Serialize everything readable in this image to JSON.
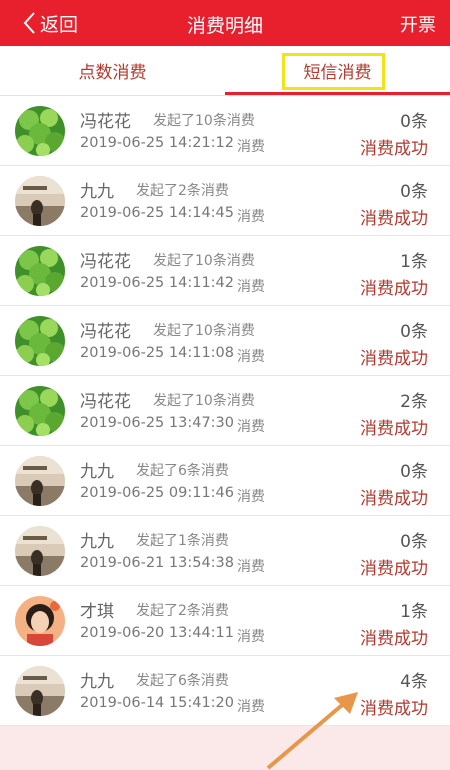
{
  "header": {
    "back_label": "返回",
    "title": "消费明细",
    "invoice_label": "开票"
  },
  "tabs": [
    {
      "label": "点数消费"
    },
    {
      "label": "短信消费"
    }
  ],
  "active_tab": 1,
  "records": [
    {
      "name": "冯花花",
      "desc": "发起了10条消费",
      "datetime": "2019-06-25 14:21:12",
      "type": "消费",
      "count": "0条",
      "status": "消费成功",
      "avatar": "leaf-avatar"
    },
    {
      "name": "九九",
      "desc": "发起了2条消费",
      "datetime": "2019-06-25 14:14:45",
      "type": "消费",
      "count": "0条",
      "status": "消费成功",
      "avatar": "room-avatar"
    },
    {
      "name": "冯花花",
      "desc": "发起了10条消费",
      "datetime": "2019-06-25 14:11:42",
      "type": "消费",
      "count": "1条",
      "status": "消费成功",
      "avatar": "leaf-avatar"
    },
    {
      "name": "冯花花",
      "desc": "发起了10条消费",
      "datetime": "2019-06-25 14:11:08",
      "type": "消费",
      "count": "0条",
      "status": "消费成功",
      "avatar": "leaf-avatar"
    },
    {
      "name": "冯花花",
      "desc": "发起了10条消费",
      "datetime": "2019-06-25 13:47:30",
      "type": "消费",
      "count": "2条",
      "status": "消费成功",
      "avatar": "leaf-avatar"
    },
    {
      "name": "九九",
      "desc": "发起了6条消费",
      "datetime": "2019-06-25 09:11:46",
      "type": "消费",
      "count": "0条",
      "status": "消费成功",
      "avatar": "room-avatar"
    },
    {
      "name": "九九",
      "desc": "发起了1条消费",
      "datetime": "2019-06-21 13:54:38",
      "type": "消费",
      "count": "0条",
      "status": "消费成功",
      "avatar": "room-avatar"
    },
    {
      "name": "才琪",
      "desc": "发起了2条消费",
      "datetime": "2019-06-20 13:44:11",
      "type": "消费",
      "count": "1条",
      "status": "消费成功",
      "avatar": "girl-avatar"
    },
    {
      "name": "九九",
      "desc": "发起了6条消费",
      "datetime": "2019-06-14 15:41:20",
      "type": "消费",
      "count": "4条",
      "status": "消费成功",
      "avatar": "room-avatar"
    }
  ],
  "colors": {
    "brand_red": "#e8202e",
    "status_red": "#b23a2e",
    "highlight_yellow": "#f3e21a",
    "annotation_orange": "#e8974a"
  }
}
